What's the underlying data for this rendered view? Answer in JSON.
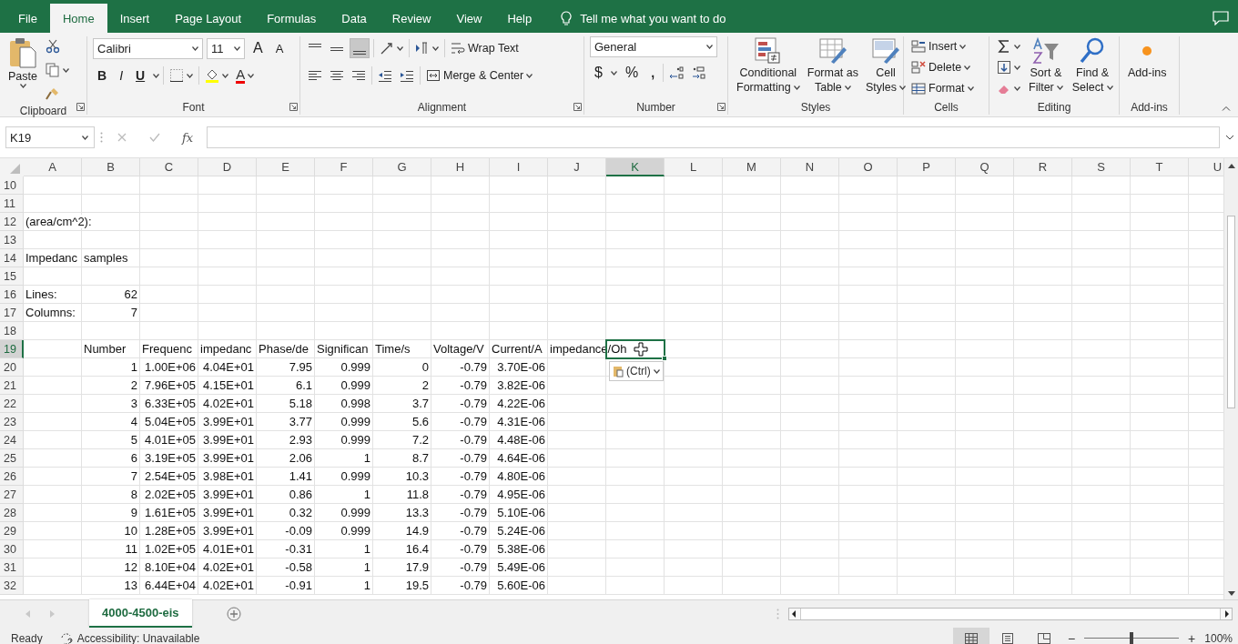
{
  "tabs": [
    {
      "label": "File",
      "selected": false
    },
    {
      "label": "Home",
      "selected": true
    },
    {
      "label": "Insert",
      "selected": false
    },
    {
      "label": "Page Layout",
      "selected": false
    },
    {
      "label": "Formulas",
      "selected": false
    },
    {
      "label": "Data",
      "selected": false
    },
    {
      "label": "Review",
      "selected": false
    },
    {
      "label": "View",
      "selected": false
    },
    {
      "label": "Help",
      "selected": false
    }
  ],
  "tell_me": {
    "placeholder": "Tell me what you want to do"
  },
  "ribbon": {
    "clipboard": {
      "label": "Clipboard",
      "paste": "Paste"
    },
    "font": {
      "label": "Font",
      "font_name": "Calibri",
      "font_size": "11",
      "grow": "A",
      "shrink": "A",
      "bold": "B",
      "italic": "I",
      "underline": "U",
      "font_color": "A"
    },
    "alignment": {
      "label": "Alignment",
      "bottom_align": {
        "selected": true
      },
      "wrap_text": "Wrap Text",
      "merge_center": "Merge & Center"
    },
    "number": {
      "label": "Number",
      "format": "General",
      "currency": "$",
      "percent": "%",
      "comma": ","
    },
    "styles": {
      "label": "Styles",
      "buttons": [
        {
          "kind": "conditional",
          "lines": [
            "Conditional",
            "Formatting"
          ]
        },
        {
          "kind": "table",
          "lines": [
            "Format as",
            "Table"
          ]
        },
        {
          "kind": "cell",
          "lines": [
            "Cell",
            "Styles"
          ]
        }
      ]
    },
    "cells": {
      "label": "Cells",
      "buttons": [
        {
          "kind": "insert",
          "label": "Insert"
        },
        {
          "kind": "delete",
          "label": "Delete"
        },
        {
          "kind": "format",
          "label": "Format"
        }
      ]
    },
    "editing": {
      "label": "Editing",
      "buttons": [
        {
          "kind": "sort",
          "lines": [
            "Sort &",
            "Filter"
          ]
        },
        {
          "kind": "find",
          "lines": [
            "Find &",
            "Select"
          ]
        }
      ]
    },
    "addins": {
      "label": "Add-ins",
      "button": "Add-ins"
    }
  },
  "formula_bar": {
    "name_box": "K19",
    "function_label": "fx"
  },
  "sheet": {
    "columns": [
      {
        "label": "A",
        "selected": false
      },
      {
        "label": "B",
        "selected": false
      },
      {
        "label": "C",
        "selected": false
      },
      {
        "label": "D",
        "selected": false
      },
      {
        "label": "E",
        "selected": false
      },
      {
        "label": "F",
        "selected": false
      },
      {
        "label": "G",
        "selected": false
      },
      {
        "label": "H",
        "selected": false
      },
      {
        "label": "I",
        "selected": false
      },
      {
        "label": "J",
        "selected": false
      },
      {
        "label": "K",
        "selected": true
      },
      {
        "label": "L",
        "selected": false
      },
      {
        "label": "M",
        "selected": false
      },
      {
        "label": "N",
        "selected": false
      },
      {
        "label": "O",
        "selected": false
      },
      {
        "label": "P",
        "selected": false
      },
      {
        "label": "Q",
        "selected": false
      },
      {
        "label": "R",
        "selected": false
      },
      {
        "label": "S",
        "selected": false
      },
      {
        "label": "T",
        "selected": false
      },
      {
        "label": "U",
        "selected": false
      }
    ],
    "rows": [
      {
        "label": "10",
        "selected": false
      },
      {
        "label": "11",
        "selected": false
      },
      {
        "label": "12",
        "selected": false,
        "cells": [
          {
            "kind": "text",
            "text": "(area/cm^2):"
          }
        ]
      },
      {
        "label": "13",
        "selected": false
      },
      {
        "label": "14",
        "selected": false,
        "cells": [
          {
            "kind": "text",
            "text": "Impedanc"
          },
          {
            "kind": "text",
            "text": "samples"
          }
        ]
      },
      {
        "label": "15",
        "selected": false
      },
      {
        "label": "16",
        "selected": false,
        "cells": [
          {
            "kind": "text",
            "text": "Lines:"
          },
          {
            "kind": "number",
            "text": "62"
          }
        ]
      },
      {
        "label": "17",
        "selected": false,
        "cells": [
          {
            "kind": "text",
            "text": "Columns:"
          },
          {
            "kind": "number",
            "text": "7"
          }
        ]
      },
      {
        "label": "18",
        "selected": false
      },
      {
        "label": "19",
        "selected": true,
        "cells": [
          null,
          {
            "kind": "text",
            "text": "Number"
          },
          {
            "kind": "text",
            "text": "Frequenc"
          },
          {
            "kind": "text",
            "text": "impedanc"
          },
          {
            "kind": "text",
            "text": "Phase/de"
          },
          {
            "kind": "text",
            "text": "Significan"
          },
          {
            "kind": "text",
            "text": "Time/s"
          },
          {
            "kind": "text",
            "text": "Voltage/V"
          },
          {
            "kind": "text",
            "text": "Current/A"
          },
          {
            "kind": "text",
            "text": "impedance/Oh"
          }
        ]
      },
      {
        "label": "20",
        "selected": false,
        "cells": [
          null,
          {
            "kind": "number",
            "text": "1"
          },
          {
            "kind": "number",
            "text": "1.00E+06"
          },
          {
            "kind": "number",
            "text": "4.04E+01"
          },
          {
            "kind": "number",
            "text": "7.95"
          },
          {
            "kind": "number",
            "text": "0.999"
          },
          {
            "kind": "number",
            "text": "0"
          },
          {
            "kind": "number",
            "text": "-0.79"
          },
          {
            "kind": "number",
            "text": "3.70E-06"
          }
        ]
      },
      {
        "label": "21",
        "selected": false,
        "cells": [
          null,
          {
            "kind": "number",
            "text": "2"
          },
          {
            "kind": "number",
            "text": "7.96E+05"
          },
          {
            "kind": "number",
            "text": "4.15E+01"
          },
          {
            "kind": "number",
            "text": "6.1"
          },
          {
            "kind": "number",
            "text": "0.999"
          },
          {
            "kind": "number",
            "text": "2"
          },
          {
            "kind": "number",
            "text": "-0.79"
          },
          {
            "kind": "number",
            "text": "3.82E-06"
          }
        ]
      },
      {
        "label": "22",
        "selected": false,
        "cells": [
          null,
          {
            "kind": "number",
            "text": "3"
          },
          {
            "kind": "number",
            "text": "6.33E+05"
          },
          {
            "kind": "number",
            "text": "4.02E+01"
          },
          {
            "kind": "number",
            "text": "5.18"
          },
          {
            "kind": "number",
            "text": "0.998"
          },
          {
            "kind": "number",
            "text": "3.7"
          },
          {
            "kind": "number",
            "text": "-0.79"
          },
          {
            "kind": "number",
            "text": "4.22E-06"
          }
        ]
      },
      {
        "label": "23",
        "selected": false,
        "cells": [
          null,
          {
            "kind": "number",
            "text": "4"
          },
          {
            "kind": "number",
            "text": "5.04E+05"
          },
          {
            "kind": "number",
            "text": "3.99E+01"
          },
          {
            "kind": "number",
            "text": "3.77"
          },
          {
            "kind": "number",
            "text": "0.999"
          },
          {
            "kind": "number",
            "text": "5.6"
          },
          {
            "kind": "number",
            "text": "-0.79"
          },
          {
            "kind": "number",
            "text": "4.31E-06"
          }
        ]
      },
      {
        "label": "24",
        "selected": false,
        "cells": [
          null,
          {
            "kind": "number",
            "text": "5"
          },
          {
            "kind": "number",
            "text": "4.01E+05"
          },
          {
            "kind": "number",
            "text": "3.99E+01"
          },
          {
            "kind": "number",
            "text": "2.93"
          },
          {
            "kind": "number",
            "text": "0.999"
          },
          {
            "kind": "number",
            "text": "7.2"
          },
          {
            "kind": "number",
            "text": "-0.79"
          },
          {
            "kind": "number",
            "text": "4.48E-06"
          }
        ]
      },
      {
        "label": "25",
        "selected": false,
        "cells": [
          null,
          {
            "kind": "number",
            "text": "6"
          },
          {
            "kind": "number",
            "text": "3.19E+05"
          },
          {
            "kind": "number",
            "text": "3.99E+01"
          },
          {
            "kind": "number",
            "text": "2.06"
          },
          {
            "kind": "number",
            "text": "1"
          },
          {
            "kind": "number",
            "text": "8.7"
          },
          {
            "kind": "number",
            "text": "-0.79"
          },
          {
            "kind": "number",
            "text": "4.64E-06"
          }
        ]
      },
      {
        "label": "26",
        "selected": false,
        "cells": [
          null,
          {
            "kind": "number",
            "text": "7"
          },
          {
            "kind": "number",
            "text": "2.54E+05"
          },
          {
            "kind": "number",
            "text": "3.98E+01"
          },
          {
            "kind": "number",
            "text": "1.41"
          },
          {
            "kind": "number",
            "text": "0.999"
          },
          {
            "kind": "number",
            "text": "10.3"
          },
          {
            "kind": "number",
            "text": "-0.79"
          },
          {
            "kind": "number",
            "text": "4.80E-06"
          }
        ]
      },
      {
        "label": "27",
        "selected": false,
        "cells": [
          null,
          {
            "kind": "number",
            "text": "8"
          },
          {
            "kind": "number",
            "text": "2.02E+05"
          },
          {
            "kind": "number",
            "text": "3.99E+01"
          },
          {
            "kind": "number",
            "text": "0.86"
          },
          {
            "kind": "number",
            "text": "1"
          },
          {
            "kind": "number",
            "text": "11.8"
          },
          {
            "kind": "number",
            "text": "-0.79"
          },
          {
            "kind": "number",
            "text": "4.95E-06"
          }
        ]
      },
      {
        "label": "28",
        "selected": false,
        "cells": [
          null,
          {
            "kind": "number",
            "text": "9"
          },
          {
            "kind": "number",
            "text": "1.61E+05"
          },
          {
            "kind": "number",
            "text": "3.99E+01"
          },
          {
            "kind": "number",
            "text": "0.32"
          },
          {
            "kind": "number",
            "text": "0.999"
          },
          {
            "kind": "number",
            "text": "13.3"
          },
          {
            "kind": "number",
            "text": "-0.79"
          },
          {
            "kind": "number",
            "text": "5.10E-06"
          }
        ]
      },
      {
        "label": "29",
        "selected": false,
        "cells": [
          null,
          {
            "kind": "number",
            "text": "10"
          },
          {
            "kind": "number",
            "text": "1.28E+05"
          },
          {
            "kind": "number",
            "text": "3.99E+01"
          },
          {
            "kind": "number",
            "text": "-0.09"
          },
          {
            "kind": "number",
            "text": "0.999"
          },
          {
            "kind": "number",
            "text": "14.9"
          },
          {
            "kind": "number",
            "text": "-0.79"
          },
          {
            "kind": "number",
            "text": "5.24E-06"
          }
        ]
      },
      {
        "label": "30",
        "selected": false,
        "cells": [
          null,
          {
            "kind": "number",
            "text": "11"
          },
          {
            "kind": "number",
            "text": "1.02E+05"
          },
          {
            "kind": "number",
            "text": "4.01E+01"
          },
          {
            "kind": "number",
            "text": "-0.31"
          },
          {
            "kind": "number",
            "text": "1"
          },
          {
            "kind": "number",
            "text": "16.4"
          },
          {
            "kind": "number",
            "text": "-0.79"
          },
          {
            "kind": "number",
            "text": "5.38E-06"
          }
        ]
      },
      {
        "label": "31",
        "selected": false,
        "cells": [
          null,
          {
            "kind": "number",
            "text": "12"
          },
          {
            "kind": "number",
            "text": "8.10E+04"
          },
          {
            "kind": "number",
            "text": "4.02E+01"
          },
          {
            "kind": "number",
            "text": "-0.58"
          },
          {
            "kind": "number",
            "text": "1"
          },
          {
            "kind": "number",
            "text": "17.9"
          },
          {
            "kind": "number",
            "text": "-0.79"
          },
          {
            "kind": "number",
            "text": "5.49E-06"
          }
        ]
      },
      {
        "label": "32",
        "selected": false,
        "cells": [
          null,
          {
            "kind": "number",
            "text": "13"
          },
          {
            "kind": "number",
            "text": "6.44E+04"
          },
          {
            "kind": "number",
            "text": "4.02E+01"
          },
          {
            "kind": "number",
            "text": "-0.91"
          },
          {
            "kind": "number",
            "text": "1"
          },
          {
            "kind": "number",
            "text": "19.5"
          },
          {
            "kind": "number",
            "text": "-0.79"
          },
          {
            "kind": "number",
            "text": "5.60E-06"
          }
        ]
      }
    ],
    "paste_options": {
      "label": "(Ctrl)"
    }
  },
  "sheet_tabs": [
    {
      "label": "4000-4500-eis",
      "selected": true
    }
  ],
  "status_bar": {
    "status": "Ready",
    "accessibility": "Accessibility: Unavailable",
    "views": [
      {
        "kind": "normal",
        "selected": true
      },
      {
        "kind": "page_layout",
        "selected": false
      },
      {
        "kind": "page_break",
        "selected": false
      }
    ],
    "zoom_out": "−",
    "zoom_slider": {
      "level": 0.5
    },
    "zoom_in": "+",
    "zoom": "100%"
  }
}
